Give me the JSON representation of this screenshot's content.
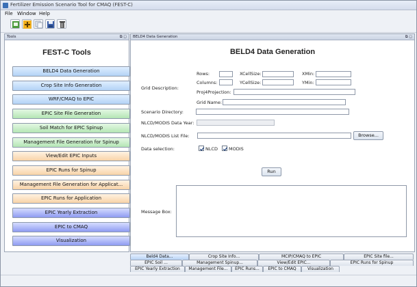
{
  "app": {
    "title": "Fertilizer Emission Scenario Tool for CMAQ (FEST-C)"
  },
  "menu": {
    "file": "File",
    "window": "Window",
    "help": "Help"
  },
  "toolbar": {
    "icons": [
      "new-icon",
      "add-icon",
      "copy-icon",
      "save-icon",
      "delete-icon"
    ]
  },
  "tools_panel": {
    "header": "Tools",
    "title": "FEST-C Tools",
    "buttons": [
      {
        "label": "BELD4 Data Generation",
        "color": "blue"
      },
      {
        "label": "Crop Site Info Generation",
        "color": "blue"
      },
      {
        "label": "WRF/CMAQ to EPIC",
        "color": "blue"
      },
      {
        "label": "EPIC Site File Generation",
        "color": "green"
      },
      {
        "label": "Soil Match for EPIC Spinup",
        "color": "green"
      },
      {
        "label": "Management File Generation for Spinup",
        "color": "green"
      },
      {
        "label": "View/Edit EPIC Inputs",
        "color": "orange"
      },
      {
        "label": "EPIC Runs for Spinup",
        "color": "orange"
      },
      {
        "label": "Management File Generation for Applicat...",
        "color": "orange"
      },
      {
        "label": "EPIC Runs for Application",
        "color": "orange"
      },
      {
        "label": "EPIC Yearly Extraction",
        "color": "purple"
      },
      {
        "label": "EPIC to CMAQ",
        "color": "purple"
      },
      {
        "label": "Visualization",
        "color": "purple"
      }
    ]
  },
  "main_panel": {
    "header": "BELD4 Data Generation",
    "title": "BELD4 Data Generation",
    "grid": {
      "section_label": "Grid Description:",
      "rows": "Rows:",
      "xcellsize": "XCellSize:",
      "xmin": "XMin:",
      "columns": "Columns:",
      "ycellsize": "YCellSize:",
      "ymin": "YMin:",
      "proj4": "Proj4Projection:",
      "grid_name": "Grid Name:"
    },
    "scenario_dir_label": "Scenario Directory:",
    "nlcd_year_label": "NLCD/MODIS Data Year:",
    "list_file_label": "NLCD/MODIS List File:",
    "browse": "Browse...",
    "data_selection_label": "Data selection:",
    "nlcd": {
      "label": "NLCD",
      "checked": true
    },
    "modis": {
      "label": "MODIS",
      "checked": true
    },
    "run": "Run",
    "message_box_label": "Message Box:"
  },
  "tabs": {
    "row1": [
      "Beld4 Data...",
      "Crop Site Info...",
      "MCIP/CMAQ to EPIC",
      "EPIC Site file..."
    ],
    "row2": [
      "EPIC Soil ...",
      "Management Spinup...",
      "View/Edit EPIC...",
      "EPIC Runs for Spinup"
    ],
    "row3": [
      "EPIC Yearly Extraction",
      "Management File...",
      "EPIC Runs...",
      "EPIC to CMAQ",
      "Visualization"
    ]
  },
  "colors": {
    "blue": "#b3d3f6",
    "green": "#b4e6b4",
    "orange": "#f8d3a8",
    "purple": "#8f9cf2"
  }
}
